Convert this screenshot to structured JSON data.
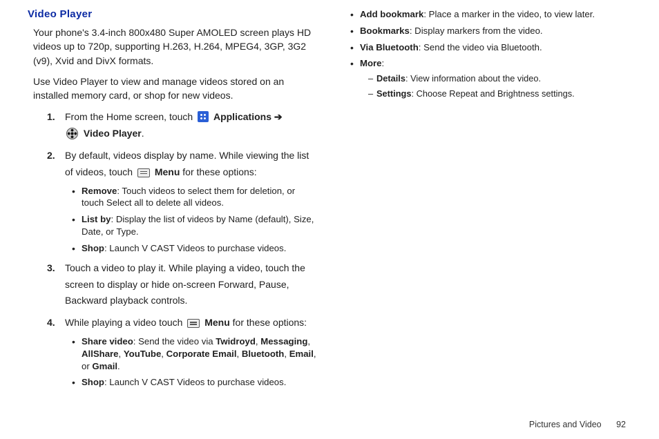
{
  "heading": "Video Player",
  "intro1": "Your phone's 3.4-inch 800x480 Super AMOLED screen plays HD videos up to 720p, supporting H.263, H.264, MPEG4, 3GP, 3G2 (v9), Xvid and DivX formats.",
  "intro2": "Use Video Player to view and manage videos stored on an installed memory card, or shop for new videos.",
  "step1": {
    "a": "From the Home screen, touch ",
    "apps": "Applications",
    "arrow": " ➔",
    "vp": "Video Player",
    "dot": "."
  },
  "step2": {
    "lead_a": "By default, videos display by name. While viewing the list of videos, touch ",
    "menu": "Menu",
    "lead_b": " for these options:",
    "items": [
      {
        "term": "Remove",
        "rest": ": Touch videos to select them for deletion, or touch Select all to delete all videos."
      },
      {
        "term": "List by",
        "rest": ": Display the list of videos by Name (default), Size, Date, or Type."
      },
      {
        "term": "Shop",
        "rest": ": Launch V CAST Videos to purchase videos."
      }
    ]
  },
  "step3": "Touch a video to play it. While playing a video, touch the screen to display or hide on-screen Forward, Pause, Backward playback controls.",
  "step4": {
    "lead_a": "While playing a video touch ",
    "menu": "Menu",
    "lead_b": " for these options:",
    "share": {
      "term": "Share video",
      "a": ": Send the video via ",
      "b1": "Twidroyd",
      "b2": "Messaging",
      "b3": "AllShare",
      "b4": "YouTube",
      "b5": "Corporate Email",
      "b6": "Bluetooth",
      "b7": "Email",
      "b8": "Gmail",
      "c": ", ",
      "or": ", or ",
      "dot": "."
    },
    "shop": {
      "term": "Shop",
      "rest": ": Launch V CAST Videos to purchase videos."
    }
  },
  "right": {
    "items": [
      {
        "term": "Add bookmark",
        "rest": ": Place a marker in the video, to view later."
      },
      {
        "term": "Bookmarks",
        "rest": ": Display markers from the video."
      },
      {
        "term": "Via Bluetooth",
        "rest": ": Send the video via Bluetooth."
      }
    ],
    "more_term": "More",
    "more_colon": ":",
    "more_sub": [
      {
        "term": "Details",
        "rest": ": View information about the video."
      },
      {
        "term": "Settings",
        "rest": ": Choose Repeat and Brightness settings."
      }
    ]
  },
  "footer": {
    "section": "Pictures and Video",
    "page": "92"
  }
}
